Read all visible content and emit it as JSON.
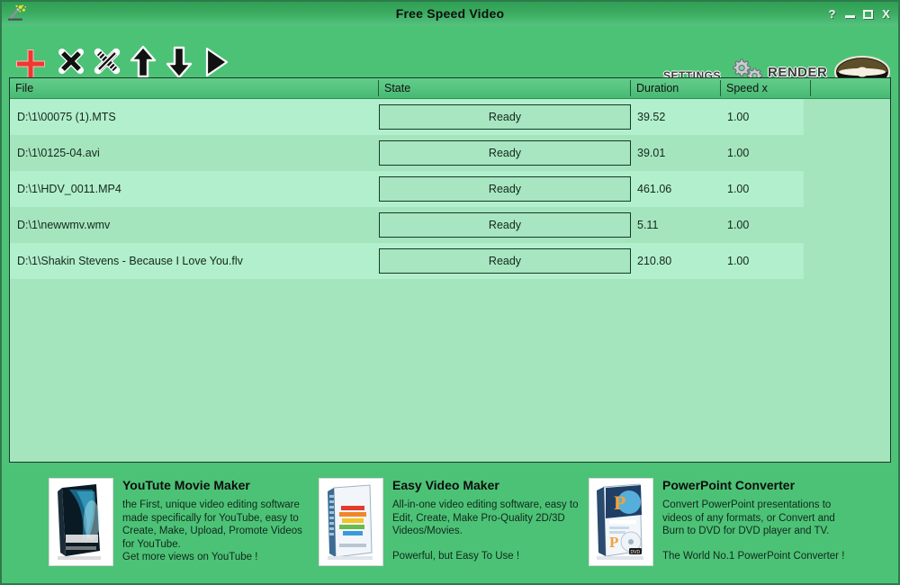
{
  "window": {
    "title": "Free Speed Video",
    "app_icon": "magic-wand-icon",
    "controls": {
      "help": "?",
      "minimize": "minimize-icon",
      "maximize": "maximize-icon",
      "close": "X"
    },
    "colors": {
      "title_bar": "#3bab60",
      "body": "#4cc276",
      "list_background": "#a5e5be",
      "row_alt": "#b2efcc",
      "header_gradient_top": "#63cc8a",
      "border": "#19392a",
      "add_icon_red": "#f04a4a"
    }
  },
  "toolbar": {
    "buttons": [
      {
        "name": "add-file-button",
        "icon": "plus-icon",
        "tooltip": "Add"
      },
      {
        "name": "remove-file-button",
        "icon": "x-icon",
        "tooltip": "Remove"
      },
      {
        "name": "remove-all-button",
        "icon": "x-striped-icon",
        "tooltip": "Remove All"
      },
      {
        "name": "move-up-button",
        "icon": "arrow-up-icon",
        "tooltip": "Move Up"
      },
      {
        "name": "move-down-button",
        "icon": "arrow-down-icon",
        "tooltip": "Move Down"
      },
      {
        "name": "play-button",
        "icon": "play-icon",
        "tooltip": "Play"
      }
    ],
    "settings_label": "Settings",
    "render_label": "Render"
  },
  "file_list": {
    "columns": [
      {
        "key": "file",
        "label": "File"
      },
      {
        "key": "state",
        "label": "State"
      },
      {
        "key": "duration",
        "label": "Duration"
      },
      {
        "key": "speed",
        "label": "Speed x"
      }
    ],
    "rows": [
      {
        "file": "D:\\1\\00075 (1).MTS",
        "state": "Ready",
        "duration": "39.52",
        "speed": "1.00"
      },
      {
        "file": "D:\\1\\0125-04.avi",
        "state": "Ready",
        "duration": "39.01",
        "speed": "1.00"
      },
      {
        "file": "D:\\1\\HDV_0011.MP4",
        "state": "Ready",
        "duration": "461.06",
        "speed": "1.00"
      },
      {
        "file": "D:\\1\\newwmv.wmv",
        "state": "Ready",
        "duration": "5.11",
        "speed": "1.00"
      },
      {
        "file": "D:\\1\\Shakin Stevens - Because I Love You.flv",
        "state": "Ready",
        "duration": "210.80",
        "speed": "1.00"
      }
    ]
  },
  "ads": [
    {
      "title": "YouTute Movie Maker",
      "body": "the First, unique video editing software\nmade specifically for YouTube, easy to\nCreate, Make, Upload, Promote Videos\nfor YouTube.\nGet more views on YouTube !",
      "tagline": "",
      "thumb": "youtube-movie-maker-box-icon"
    },
    {
      "title": "Easy Video Maker",
      "body": "All-in-one video editing software, easy to\nEdit, Create, Make Pro-Quality 2D/3D\nVideos/Movies.",
      "tagline": "Powerful, but Easy To Use !",
      "thumb": "easy-video-maker-box-icon"
    },
    {
      "title": "PowerPoint Converter",
      "body": "Convert PowerPoint presentations to\nvideos of any formats, or Convert and\nBurn to DVD for DVD player and TV.",
      "tagline": "The World No.1 PowerPoint Converter !",
      "thumb": "powerpoint-converter-box-icon"
    }
  ]
}
